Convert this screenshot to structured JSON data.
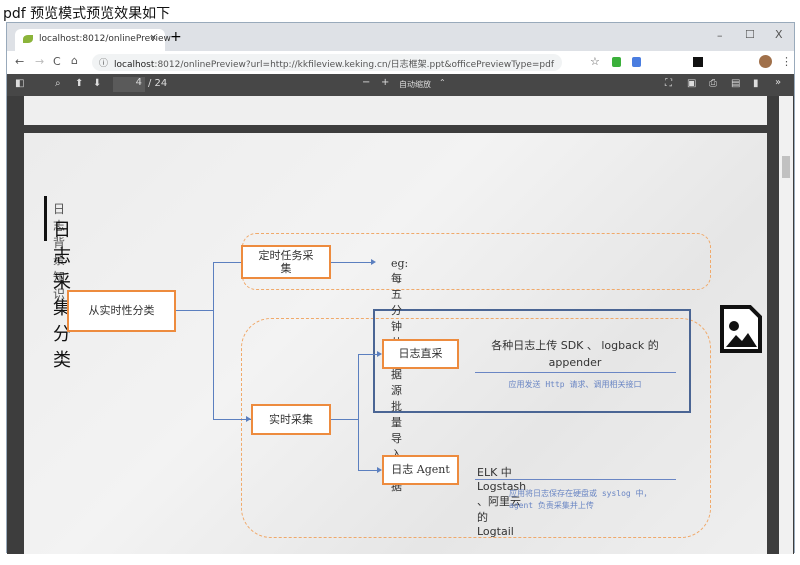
{
  "caption": "pdf 预览模式预览效果如下",
  "browser": {
    "tab_title": "localhost:8012/onlinePreview",
    "url_host": "localhost",
    "url_rest": ":8012/onlinePreview?url=http://kkfileview.keking.cn/日志框架.ppt&officePreviewType=pdf",
    "new_tab": "+",
    "minimize": "–",
    "maximize": "☐",
    "close": "X",
    "tab_close": "×"
  },
  "pdf_toolbar": {
    "page_current": "4",
    "page_total": "/ 24",
    "zoom": "自动缩放",
    "zoom_caret": "⌃",
    "minus": "−",
    "plus": "+"
  },
  "slide": {
    "subtitle": "日志背景知识",
    "title": "日志采集分类",
    "root": "从实时性分类",
    "scheduled": "定时任务采集",
    "scheduled_example": "eg: 每五分钟从数据源批量导入数据",
    "realtime": "实时采集",
    "direct": "日志直采",
    "direct_desc": "各种日志上传 SDK 、 logback 的 appender",
    "direct_sub": "应用发送 Http 请求、调用相关接口",
    "agent": "日志 Agent",
    "agent_desc": "ELK 中 Logstash 、阿里云的 Logtail",
    "agent_sub": "应用将日志保存在硬盘或 syslog 中， agent 负责采集并上传"
  },
  "colors": {
    "box_border": "#ed8b3e",
    "connector": "#5b7fbf",
    "highlight": "#4a6594",
    "toolbar": "#474747"
  }
}
